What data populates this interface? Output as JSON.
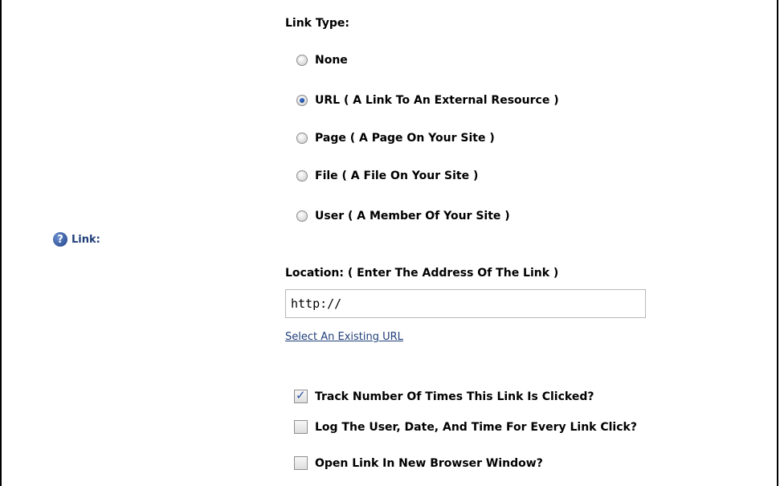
{
  "field": {
    "label": "Link:",
    "help_icon": "question-circle-icon"
  },
  "link_type": {
    "heading": "Link Type:",
    "options": [
      {
        "label": "None",
        "selected": false
      },
      {
        "label": "URL ( A Link To An External Resource )",
        "selected": true
      },
      {
        "label": "Page ( A Page On Your Site )",
        "selected": false
      },
      {
        "label": "File ( A File On Your Site )",
        "selected": false
      },
      {
        "label": "User ( A Member Of Your Site )",
        "selected": false
      }
    ]
  },
  "location": {
    "heading": "Location: ( Enter The Address Of The Link )",
    "value": "http://",
    "select_existing_link": "Select An Existing URL"
  },
  "options": [
    {
      "label": "Track Number Of Times This Link Is Clicked?",
      "checked": true
    },
    {
      "label": "Log The User, Date, And Time For Every Link Click?",
      "checked": false
    },
    {
      "label": "Open Link In New Browser Window?",
      "checked": false
    }
  ]
}
